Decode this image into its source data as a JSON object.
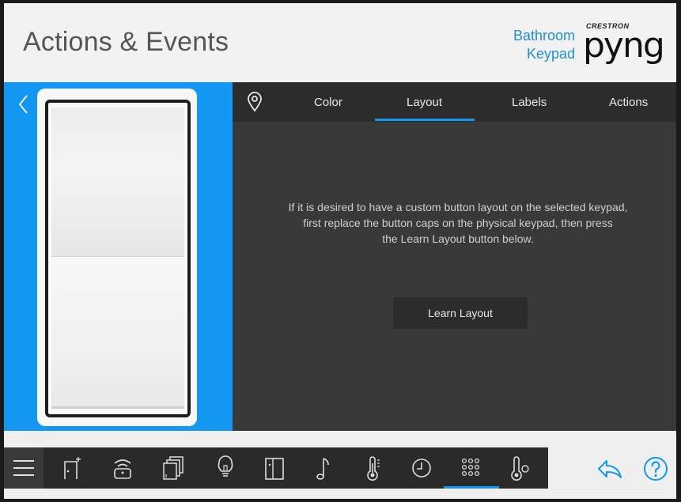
{
  "header": {
    "title": "Actions & Events",
    "room_line1": "Bathroom",
    "room_line2": "Keypad",
    "logo_brand": "CRESTRON",
    "logo_name": "pyng"
  },
  "tabs": [
    {
      "label": "Color"
    },
    {
      "label": "Layout",
      "selected": true
    },
    {
      "label": "Labels"
    },
    {
      "label": "Actions"
    }
  ],
  "main": {
    "message_line1": "If it is desired to have a custom button layout on the selected keypad,",
    "message_line2": "first replace the button caps on the physical keypad, then press",
    "message_line3": "the Learn Layout button below.",
    "learn_button": "Learn Layout"
  },
  "toolbar": {
    "items": [
      {
        "icon": "menu-icon"
      },
      {
        "icon": "add-device-icon"
      },
      {
        "icon": "remote-icon"
      },
      {
        "icon": "shades-icon"
      },
      {
        "icon": "lightbulb-icon"
      },
      {
        "icon": "door-icon"
      },
      {
        "icon": "music-note-icon"
      },
      {
        "icon": "thermometer-icon"
      },
      {
        "icon": "clock-icon"
      },
      {
        "icon": "keypad-icon",
        "selected": true
      },
      {
        "icon": "thermostat-sensor-icon"
      },
      {
        "icon": "share-icon"
      },
      {
        "icon": "help-icon"
      }
    ]
  },
  "colors": {
    "accent": "#1497f2",
    "header_text": "#555555",
    "room_text": "#1e8fd8",
    "panel_dark": "#393939"
  }
}
